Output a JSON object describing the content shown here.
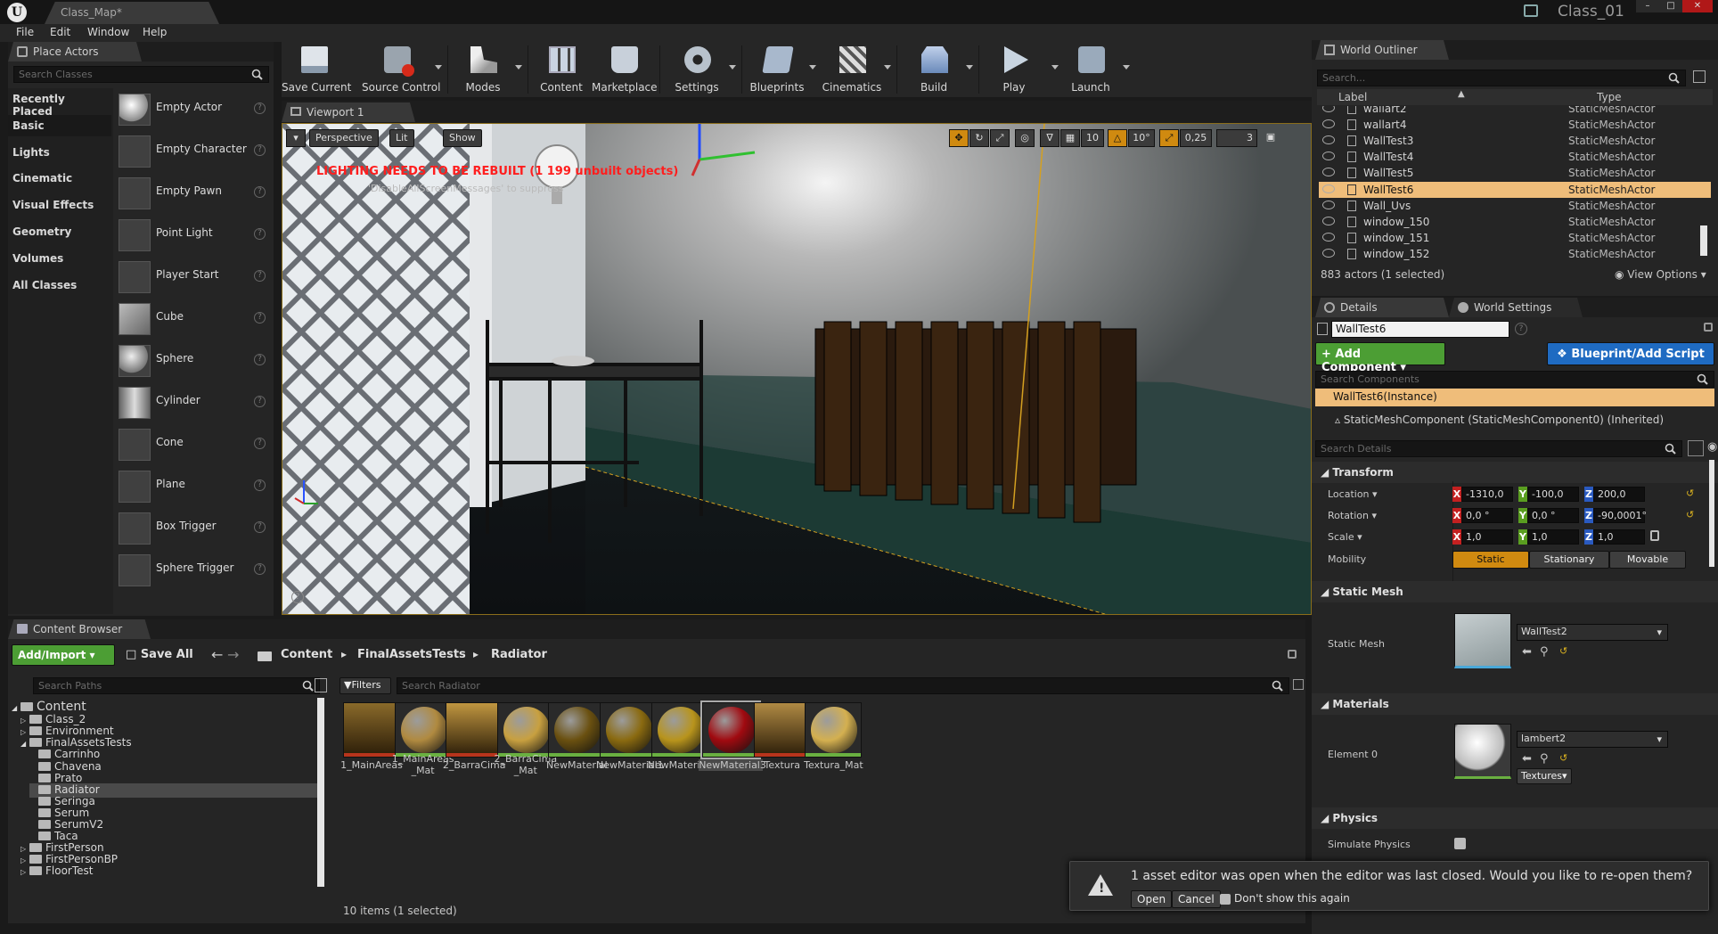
{
  "window": {
    "tab_title": "Class_Map*",
    "project": "Class_01"
  },
  "menu": [
    "File",
    "Edit",
    "Window",
    "Help"
  ],
  "place_actors": {
    "tab": "Place Actors",
    "search_placeholder": "Search Classes",
    "categories": [
      "Recently Placed",
      "Basic",
      "Lights",
      "Cinematic",
      "Visual Effects",
      "Geometry",
      "Volumes",
      "All Classes"
    ],
    "selected_category": "Basic",
    "items": [
      "Empty Actor",
      "Empty Character",
      "Empty Pawn",
      "Point Light",
      "Player Start",
      "Cube",
      "Sphere",
      "Cylinder",
      "Cone",
      "Plane",
      "Box Trigger",
      "Sphere Trigger"
    ]
  },
  "toolbar": [
    "Save Current",
    "Source Control",
    "Modes",
    "Content",
    "Marketplace",
    "Settings",
    "Blueprints",
    "Cinematics",
    "Build",
    "Play",
    "Launch"
  ],
  "viewport": {
    "tab": "Viewport 1",
    "perspective": "Perspective",
    "lit": "Lit",
    "show": "Show",
    "warning": "LIGHTING NEEDS TO BE REBUILT (1 199 unbuilt objects)",
    "suppress": "'DisableAllScreenMessages' to suppress",
    "grid": "10",
    "rot": "10°",
    "scale": "0,25",
    "cam_speed": "3"
  },
  "content_browser": {
    "tab": "Content Browser",
    "add_import": "Add/Import",
    "save_all": "Save All",
    "path": [
      "Content",
      "FinalAssetsTests",
      "Radiator"
    ],
    "search_paths": "Search Paths",
    "filters": "Filters",
    "search_assets": "Search Radiator",
    "tree": [
      {
        "name": "Content",
        "level": 0,
        "exp": "open"
      },
      {
        "name": "Class_2",
        "level": 1,
        "exp": "closed"
      },
      {
        "name": "Environment",
        "level": 1,
        "exp": "closed"
      },
      {
        "name": "FinalAssetsTests",
        "level": 1,
        "exp": "open"
      },
      {
        "name": "Carrinho",
        "level": 2,
        "exp": ""
      },
      {
        "name": "Chavena",
        "level": 2,
        "exp": ""
      },
      {
        "name": "Prato",
        "level": 2,
        "exp": ""
      },
      {
        "name": "Radiator",
        "level": 2,
        "exp": "",
        "sel": true
      },
      {
        "name": "Seringa",
        "level": 2,
        "exp": ""
      },
      {
        "name": "Serum",
        "level": 2,
        "exp": ""
      },
      {
        "name": "SerumV2",
        "level": 2,
        "exp": ""
      },
      {
        "name": "Taca",
        "level": 2,
        "exp": ""
      },
      {
        "name": "FirstPerson",
        "level": 1,
        "exp": "closed"
      },
      {
        "name": "FirstPersonBP",
        "level": 1,
        "exp": "closed"
      },
      {
        "name": "FloorTest",
        "level": 1,
        "exp": "closed"
      }
    ],
    "assets": [
      {
        "name": "1_MainAreas",
        "kind": "tex",
        "bar": "r",
        "color": "#8a6a2a"
      },
      {
        "name": "1_MainAreas _Mat",
        "kind": "sph",
        "bar": "g",
        "color": "#b08a40"
      },
      {
        "name": "2_BarraCima",
        "kind": "tex",
        "bar": "r",
        "color": "#c09640"
      },
      {
        "name": "2_BarraCima _Mat",
        "kind": "sph",
        "bar": "g",
        "color": "#c8a040"
      },
      {
        "name": "NewMaterial",
        "kind": "sph",
        "bar": "g",
        "color": "#6a5010"
      },
      {
        "name": "NewMaterial1",
        "kind": "sph",
        "bar": "g",
        "color": "#8a6a10"
      },
      {
        "name": "NewMaterial2",
        "kind": "sph",
        "bar": "g",
        "color": "#b8941c"
      },
      {
        "name": "NewMaterial3",
        "kind": "sph",
        "bar": "g",
        "color": "#a00a10",
        "sel": true
      },
      {
        "name": "Textura",
        "kind": "tex",
        "bar": "r",
        "color": "#b08a44"
      },
      {
        "name": "Textura_Mat",
        "kind": "sph",
        "bar": "g",
        "color": "#d4b050"
      }
    ],
    "status": "10 items (1 selected)"
  },
  "outliner": {
    "tab": "World Outliner",
    "search_placeholder": "Search...",
    "col_label": "Label",
    "col_type": "Type",
    "rows": [
      {
        "name": "wallart2",
        "type": "StaticMeshActor"
      },
      {
        "name": "wallart4",
        "type": "StaticMeshActor"
      },
      {
        "name": "WallTest3",
        "type": "StaticMeshActor"
      },
      {
        "name": "WallTest4",
        "type": "StaticMeshActor"
      },
      {
        "name": "WallTest5",
        "type": "StaticMeshActor"
      },
      {
        "name": "WallTest6",
        "type": "StaticMeshActor",
        "sel": true
      },
      {
        "name": "Wall_Uvs",
        "type": "StaticMeshActor"
      },
      {
        "name": "window_150",
        "type": "StaticMeshActor"
      },
      {
        "name": "window_151",
        "type": "StaticMeshActor"
      },
      {
        "name": "window_152",
        "type": "StaticMeshActor"
      }
    ],
    "status": "883 actors (1 selected)",
    "view_options": "View Options"
  },
  "details": {
    "tab": "Details",
    "tab2": "World Settings",
    "name": "WallTest6",
    "add_component": "+ Add Component",
    "blueprint": "Blueprint/Add Script",
    "search_components": "Search Components",
    "instance": "WallTest6(Instance)",
    "component": "StaticMeshComponent (StaticMeshComponent0) (Inherited)",
    "search_details": "Search Details",
    "transform": "Transform",
    "location": {
      "label": "Location",
      "x": "-1310,0",
      "y": "-100,0",
      "z": "200,0"
    },
    "rotation": {
      "label": "Rotation",
      "x": "0,0 °",
      "y": "0,0 °",
      "z": "-90,0001°"
    },
    "scale": {
      "label": "Scale",
      "x": "1,0",
      "y": "1,0",
      "z": "1,0"
    },
    "mobility": {
      "label": "Mobility",
      "static": "Static",
      "stationary": "Stationary",
      "movable": "Movable"
    },
    "static_mesh_section": "Static Mesh",
    "static_mesh_label": "Static Mesh",
    "static_mesh_value": "WallTest2",
    "materials_section": "Materials",
    "element0": "Element 0",
    "material_value": "lambert2",
    "textures": "Textures",
    "physics_section": "Physics",
    "simulate_physics": "Simulate Physics"
  },
  "toast": {
    "message": "1 asset editor was open when the editor was last closed. Would you like to re-open them?",
    "open": "Open",
    "cancel": "Cancel",
    "dont_show": "Don't show this again"
  }
}
